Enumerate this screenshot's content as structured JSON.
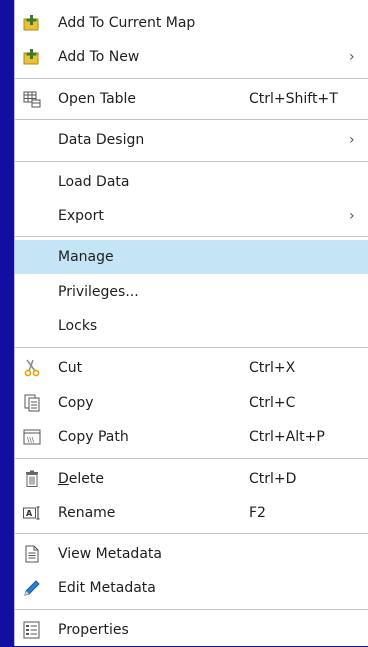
{
  "menu": {
    "items": [
      {
        "label": "Add To Current Map",
        "icon": "add-layer-icon"
      },
      {
        "label": "Add To New",
        "icon": "add-layer-icon",
        "submenu": "›"
      },
      {
        "label": "Open Table",
        "icon": "table-icon",
        "shortcut": "Ctrl+Shift+T"
      },
      {
        "label": "Data Design",
        "submenu": "›"
      },
      {
        "label": "Load Data"
      },
      {
        "label": "Export",
        "submenu": "›"
      },
      {
        "label": "Manage",
        "highlighted": true
      },
      {
        "label": "Privileges..."
      },
      {
        "label": "Locks"
      },
      {
        "label": "Cut",
        "icon": "scissors-icon",
        "shortcut": "Ctrl+X"
      },
      {
        "label": "Copy",
        "icon": "copy-icon",
        "shortcut": "Ctrl+C"
      },
      {
        "label": "Copy Path",
        "icon": "copy-path-icon",
        "shortcut": "Ctrl+Alt+P"
      },
      {
        "label_prefix": "D",
        "label_rest": "elete",
        "label": "Delete",
        "icon": "trash-icon",
        "shortcut": "Ctrl+D"
      },
      {
        "label": "Rename",
        "icon": "rename-icon",
        "shortcut": "F2"
      },
      {
        "label": "View Metadata",
        "icon": "document-icon"
      },
      {
        "label": "Edit Metadata",
        "icon": "pencil-icon"
      },
      {
        "label": "Properties",
        "icon": "properties-icon"
      }
    ]
  },
  "colors": {
    "background": "#120fa0",
    "highlight": "#c5e5f7",
    "separator": "#c4c4c4"
  }
}
